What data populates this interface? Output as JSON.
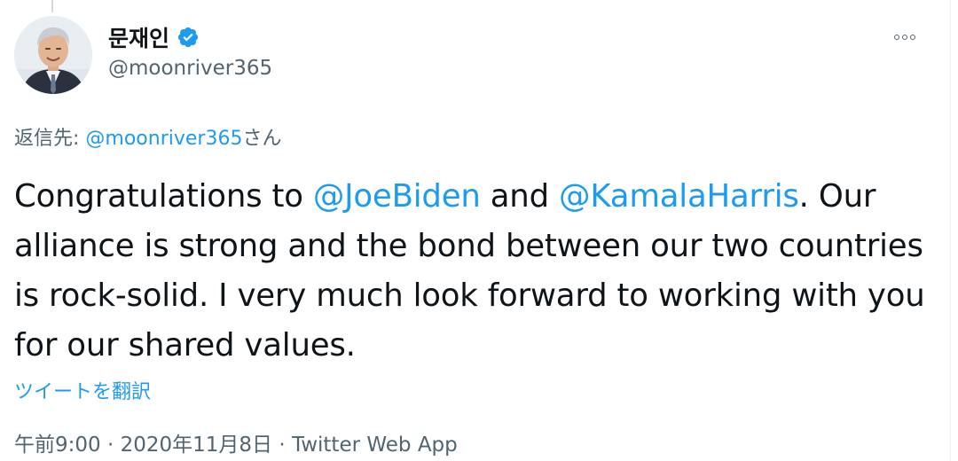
{
  "author": {
    "display_name": "문재인",
    "handle": "@moonriver365",
    "verified_icon": "verified-badge-icon",
    "avatar_icon": "profile-photo"
  },
  "reply": {
    "prefix": "返信先: ",
    "mention": "@moonriver365",
    "suffix": "さん"
  },
  "tweet": {
    "part1": "Congratulations to ",
    "mention1": "@JoeBiden",
    "part2": " and ",
    "mention2": "@KamalaHarris",
    "part3": ". Our alliance is strong and the bond between our two countries is rock-solid. I very much look forward to working with you for our shared values."
  },
  "translate_label": "ツイートを翻訳",
  "meta": {
    "time": "午前9:00",
    "sep1": " · ",
    "date": "2020年11月8日",
    "sep2": " · ",
    "source": "Twitter Web App"
  },
  "colors": {
    "link": "#1d9bf0",
    "secondary_text": "#536471",
    "primary_text": "#0f1419"
  }
}
